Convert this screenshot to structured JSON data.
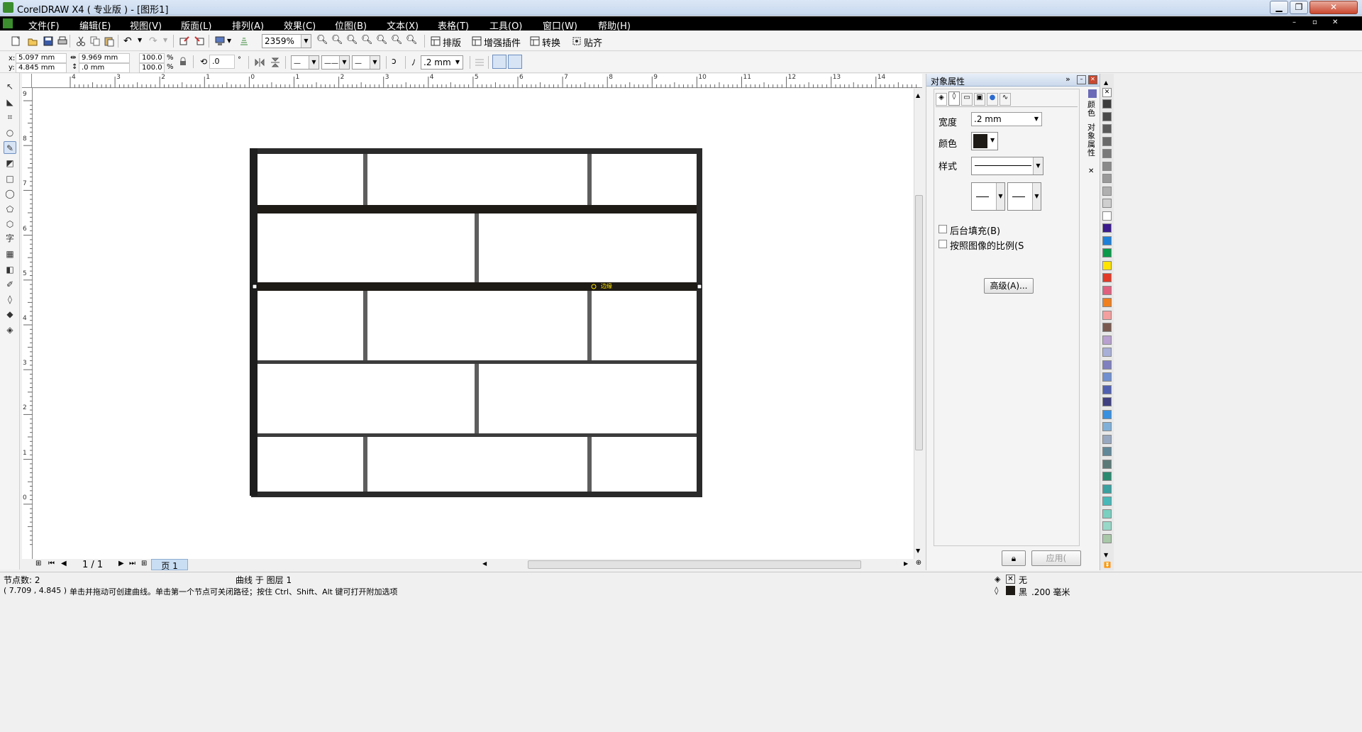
{
  "window": {
    "title": "CorelDRAW X4 ( 专业版 ) - [图形1]"
  },
  "menu": [
    "文件(F)",
    "编辑(E)",
    "视图(V)",
    "版面(L)",
    "排列(A)",
    "效果(C)",
    "位图(B)",
    "文本(X)",
    "表格(T)",
    "工具(O)",
    "窗口(W)",
    "帮助(H)"
  ],
  "toolbar": {
    "zoom": "2359%",
    "buttons": [
      "排版",
      "增强插件",
      "转换",
      "贴齐"
    ]
  },
  "propbar": {
    "x": "5.097 mm",
    "y": "4.845 mm",
    "w": "9.969 mm",
    "h": ".0 mm",
    "scale_w": "100.0",
    "scale_h": "100.0",
    "pct": "%",
    "angle": ".0",
    "deg": "°",
    "outline": ".2 mm",
    "x_label": "x:",
    "y_label": "y:"
  },
  "ruler": {
    "h_ticks": [
      "4",
      "3",
      "2",
      "1",
      "0",
      "1",
      "2",
      "3",
      "4",
      "5",
      "6",
      "7",
      "8",
      "9",
      "10",
      "11",
      "12",
      "13",
      "14"
    ],
    "v_ticks": [
      "9",
      "8",
      "7",
      "6",
      "5",
      "4",
      "3",
      "2",
      "1",
      "0"
    ]
  },
  "canvas": {
    "node_label": "边缘"
  },
  "pagenav": {
    "page_count": "1 / 1",
    "page_tab": "页 1"
  },
  "docker": {
    "title": "对象属性",
    "width_label": "宽度",
    "width_value": ".2 mm",
    "color_label": "颜色",
    "style_label": "样式",
    "behind_fill": "后台填充(B)",
    "scale_with_image": "按照图像的比例(S",
    "advanced": "高级(A)...",
    "apply": "应用(",
    "side_tabs": [
      "颜色",
      "对象属性"
    ]
  },
  "palette": [
    "#3c3c3c",
    "#4a4a4a",
    "#5a5a5a",
    "#6a6a6a",
    "#7a7a7a",
    "#8a8a8a",
    "#9a9a9a",
    "#b0b0b0",
    "#cfcfcf",
    "#ffffff",
    "#3a1a8c",
    "#1e7fd8",
    "#0a9a4a",
    "#ffe400",
    "#e23a26",
    "#e0607e",
    "#f07f1e",
    "#f49f9f",
    "#7a5a50",
    "#b8a0d0",
    "#a8b0d8",
    "#8080c0",
    "#7090d0",
    "#5060b0",
    "#404080",
    "#3890e0",
    "#80b0d8",
    "#98a8c0",
    "#608898",
    "#5a7a78",
    "#2a8a70",
    "#3aa0a0",
    "#48b8b8",
    "#7ad0c0",
    "#98d8c8",
    "#a8c8a8"
  ],
  "status": {
    "nodes": "节点数: 2",
    "layer": "曲线 于 图层 1",
    "coords": "( 7.709 , 4.845 )",
    "hint": "单击并拖动可创建曲线。单击第一个节点可关闭路径；按住 Ctrl、Shift、Alt 键可打开附加选项",
    "fill": "无",
    "outline_color": "黑",
    "outline_width": ".200 毫米"
  }
}
